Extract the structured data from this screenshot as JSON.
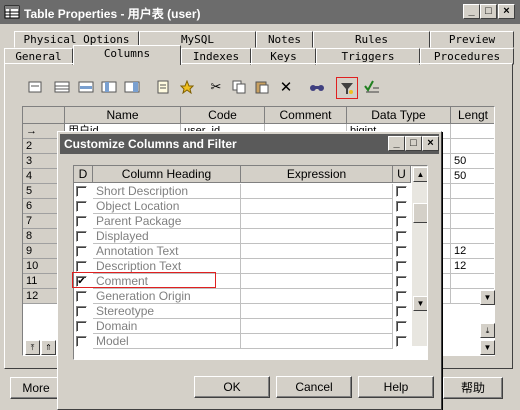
{
  "window": {
    "title": "Table Properties - 用户表 (user)",
    "controls": {
      "minimize": "_",
      "maximize": "□",
      "close": "×"
    }
  },
  "tabs_row1": [
    "Physical Options",
    "MySQL",
    "Notes",
    "Rules",
    "Preview"
  ],
  "tabs_row2": [
    "General",
    "Columns",
    "Indexes",
    "Keys",
    "Triggers",
    "Procedures"
  ],
  "active_tab": "Columns",
  "grid": {
    "headers": [
      "Name",
      "Code",
      "Comment",
      "Data Type",
      "Lengt"
    ],
    "rows": [
      {
        "num": "→",
        "name": "用户id",
        "code": "user_id",
        "comment": "",
        "type": "bigint",
        "length": ""
      },
      {
        "num": "2",
        "name": "",
        "code": "",
        "comment": "",
        "type": "",
        "length": ""
      },
      {
        "num": "3",
        "name": "",
        "code": "",
        "comment": "",
        "type": "",
        "length": "50"
      },
      {
        "num": "4",
        "name": "",
        "code": "",
        "comment": "",
        "type": "",
        "length": "50"
      },
      {
        "num": "5",
        "name": "",
        "code": "",
        "comment": "",
        "type": "",
        "length": ""
      },
      {
        "num": "6",
        "name": "",
        "code": "",
        "comment": "",
        "type": "",
        "length": ""
      },
      {
        "num": "7",
        "name": "",
        "code": "",
        "comment": "",
        "type": "",
        "length": ""
      },
      {
        "num": "8",
        "name": "",
        "code": "",
        "comment": "",
        "type": "",
        "length": ""
      },
      {
        "num": "9",
        "name": "",
        "code": "",
        "comment": "",
        "type": "",
        "length": "12"
      },
      {
        "num": "10",
        "name": "",
        "code": "",
        "comment": "",
        "type": "",
        "length": "12"
      },
      {
        "num": "11",
        "name": "",
        "code": "",
        "comment": "",
        "type": "",
        "length": ""
      },
      {
        "num": "12",
        "name": "",
        "code": "",
        "comment": "",
        "type": "",
        "length": ""
      }
    ]
  },
  "buttons": {
    "more": "More",
    "help_cn": "帮助"
  },
  "dialog": {
    "title": "Customize Columns and Filter",
    "headers": {
      "d": "D",
      "heading": "Column Heading",
      "expression": "Expression",
      "u": "U"
    },
    "rows": [
      {
        "label": "Short Description",
        "checked": false
      },
      {
        "label": "Object Location",
        "checked": false
      },
      {
        "label": "Parent Package",
        "checked": false
      },
      {
        "label": "Displayed",
        "checked": false
      },
      {
        "label": "Annotation Text",
        "checked": false
      },
      {
        "label": "Description Text",
        "checked": false
      },
      {
        "label": "Comment",
        "checked": true
      },
      {
        "label": "Generation Origin",
        "checked": false
      },
      {
        "label": "Stereotype",
        "checked": false
      },
      {
        "label": "Domain",
        "checked": false
      },
      {
        "label": "Model",
        "checked": false
      }
    ],
    "buttons": {
      "ok": "OK",
      "cancel": "Cancel",
      "help": "Help"
    }
  },
  "colors": {
    "highlight_red": "#e02020",
    "title_bar": "#6c6c6c"
  }
}
